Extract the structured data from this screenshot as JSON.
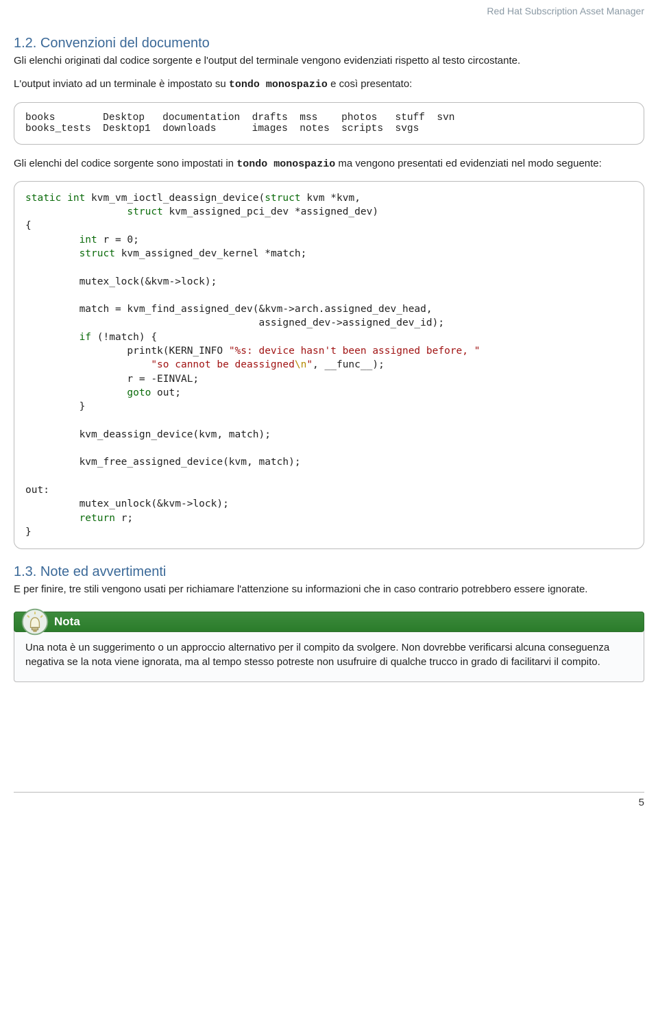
{
  "header": {
    "product": "Red Hat Subscription Asset Manager"
  },
  "sections": {
    "s12": {
      "heading": "1.2. Convenzioni del documento",
      "p1": "Gli elenchi originati dal codice sorgente e l'output del terminale vengono evidenziati rispetto al testo circostante.",
      "p2_a": "L'output inviato ad un terminale è impostato su ",
      "p2_mono": "tondo monospazio",
      "p2_b": " e così presentato:",
      "terminal": "books        Desktop   documentation  drafts  mss    photos   stuff  svn\nbooks_tests  Desktop1  downloads      images  notes  scripts  svgs",
      "p3_a": "Gli elenchi del codice sorgente sono impostati in ",
      "p3_mono": "tondo monospazio",
      "p3_b": " ma vengono presentati ed evidenziati nel modo seguente:"
    },
    "s13": {
      "heading": "1.3. Note ed avvertimenti",
      "p1": "E per finire, tre stili vengono usati per richiamare l'attenzione su informazioni che in caso contrario potrebbero essere ignorate."
    }
  },
  "code": {
    "l01_kw1": "static",
    "l01_kw2": "int",
    "l01_fn": " kvm_vm_ioctl_deassign_device(",
    "l01_kw3": "struct",
    "l01_rest": " kvm *kvm,",
    "l02_pad": "                 ",
    "l02_kw": "struct",
    "l02_rest": " kvm_assigned_pci_dev *assigned_dev)",
    "l03": "{",
    "l04_pad": "         ",
    "l04_kw": "int",
    "l04_rest": " r = 0;",
    "l05_pad": "         ",
    "l05_kw": "struct",
    "l05_rest": " kvm_assigned_dev_kernel *match;",
    "l06": "",
    "l07": "         mutex_lock(&kvm->lock);",
    "l08": "",
    "l09": "         match = kvm_find_assigned_dev(&kvm->arch.assigned_dev_head,",
    "l10": "                                       assigned_dev->assigned_dev_id);",
    "l11_pad": "         ",
    "l11_kw": "if",
    "l11_rest": " (!match) {",
    "l12_pad": "                 printk(KERN_INFO ",
    "l12_str": "\"%s: device hasn't been assigned before, \"",
    "l13_pad": "                     ",
    "l13_str1": "\"so cannot be deassigned",
    "l13_esc": "\\n",
    "l13_str2": "\"",
    "l13_rest": ", __func__);",
    "l14": "                 r = -EINVAL;",
    "l15_pad": "                 ",
    "l15_kw": "goto",
    "l15_rest": " out;",
    "l16": "         }",
    "l17": "",
    "l18": "         kvm_deassign_device(kvm, match);",
    "l19": "",
    "l20": "         kvm_free_assigned_device(kvm, match);",
    "l21": "",
    "l22": "out:",
    "l23": "         mutex_unlock(&kvm->lock);",
    "l24_pad": "         ",
    "l24_kw": "return",
    "l24_rest": " r;",
    "l25": "}"
  },
  "note": {
    "title": "Nota",
    "body": "Una nota è un suggerimento o un approccio alternativo per il compito da svolgere. Non dovrebbe verificarsi alcuna conseguenza negativa se la nota viene ignorata, ma al tempo stesso potreste non usufruire di qualche trucco in grado di facilitarvi il compito."
  },
  "page_number": "5"
}
